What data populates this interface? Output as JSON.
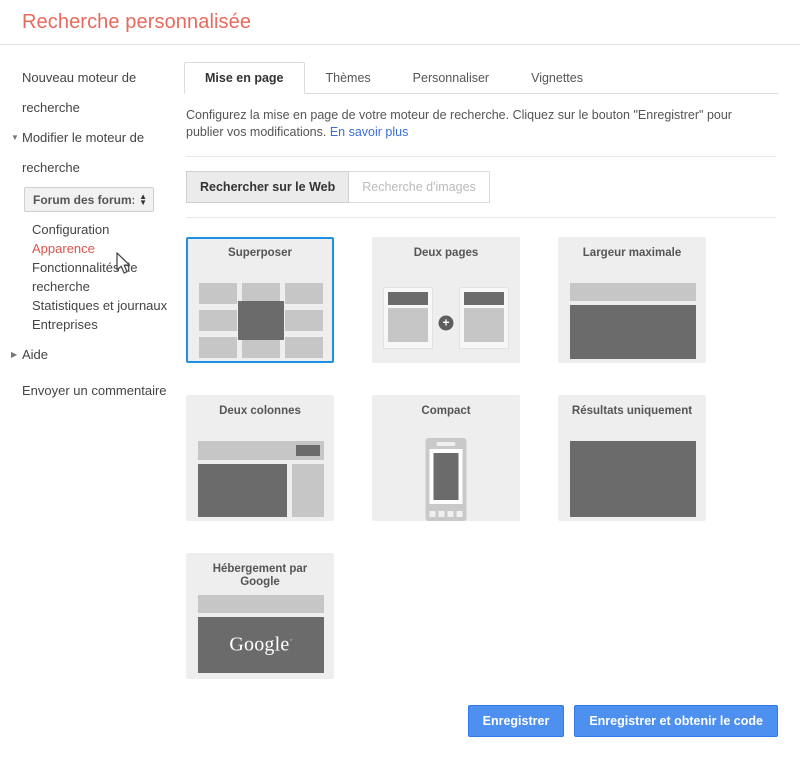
{
  "header": {
    "title": "Recherche personnalisée"
  },
  "sidebar": {
    "new_engine": "Nouveau moteur de recherche",
    "edit_engine": "Modifier le moteur de recherche",
    "engine_select": {
      "value": "Forum des forum:"
    },
    "subnav": [
      {
        "label": "Configuration",
        "active": false
      },
      {
        "label": "Apparence",
        "active": true
      },
      {
        "label": "Fonctionnalités de recherche",
        "active": false
      },
      {
        "label": "Statistiques et journaux",
        "active": false
      },
      {
        "label": "Entreprises",
        "active": false
      }
    ],
    "help": "Aide",
    "feedback": "Envoyer un commentaire"
  },
  "main": {
    "tabs": [
      {
        "label": "Mise en page",
        "active": true
      },
      {
        "label": "Thèmes",
        "active": false
      },
      {
        "label": "Personnaliser",
        "active": false
      },
      {
        "label": "Vignettes",
        "active": false
      }
    ],
    "description": "Configurez la mise en page de votre moteur de recherche. Cliquez sur le bouton \"Enregistrer\" pour publier vos modifications.",
    "learn_more": "En savoir plus",
    "segmented": [
      {
        "label": "Rechercher sur le Web",
        "active": true
      },
      {
        "label": "Recherche d'images",
        "active": false
      }
    ],
    "layouts": [
      {
        "id": "superposer",
        "label": "Superposer",
        "selected": true
      },
      {
        "id": "deux-pages",
        "label": "Deux pages",
        "selected": false
      },
      {
        "id": "largeur-maximale",
        "label": "Largeur maximale",
        "selected": false
      },
      {
        "id": "deux-colonnes",
        "label": "Deux colonnes",
        "selected": false
      },
      {
        "id": "compact",
        "label": "Compact",
        "selected": false
      },
      {
        "id": "resultats-uniquement",
        "label": "Résultats uniquement",
        "selected": false
      },
      {
        "id": "hebergement-google",
        "label": "Hébergement par Google",
        "selected": false
      }
    ],
    "google_wordmark": "Google"
  },
  "footer": {
    "save": "Enregistrer",
    "save_get_code": "Enregistrer et obtenir le code"
  },
  "colors": {
    "title": "#e8695e",
    "accent_blue": "#4d90f0",
    "selected_border": "#1e90e8",
    "active_link": "#d9544e"
  }
}
